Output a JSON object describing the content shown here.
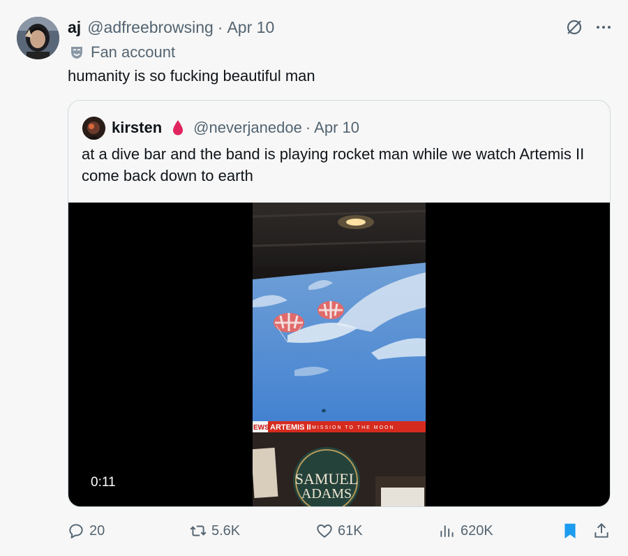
{
  "post": {
    "author_name": "aj",
    "handle": "@adfreebrowsing",
    "separator": "·",
    "date": "Apr 10",
    "badge_label": "Fan account",
    "text": "humanity is so fucking beautiful man"
  },
  "quote": {
    "author_name": "kirsten",
    "handle": "@neverjanedoe",
    "separator": "·",
    "date": "Apr 10",
    "text": "at a dive bar and the band is playing rocket man while we watch Artemis II come back down to earth",
    "video": {
      "duration": "0:11",
      "ticker_left": "EWS",
      "ticker_title": "ARTEMIS II",
      "ticker_sub": "MISSION TO THE MOON",
      "sign_line1": "SAMUEL",
      "sign_line2": "ADAMS"
    }
  },
  "actions": {
    "replies": "20",
    "reposts": "5.6K",
    "likes": "61K",
    "views": "620K"
  },
  "colors": {
    "text_primary": "#0f1419",
    "text_secondary": "#536471",
    "accent_blue": "#1d9bf0",
    "blood_drop": "#e0245e",
    "ticker_red": "#d52b1e"
  },
  "icons": {
    "grok": "grok-icon",
    "more": "more-icon",
    "fan_badge": "theater-mask-icon",
    "reply": "reply-icon",
    "repost": "repost-icon",
    "like": "heart-icon",
    "views": "views-icon",
    "bookmark": "bookmark-icon",
    "share": "share-icon"
  }
}
